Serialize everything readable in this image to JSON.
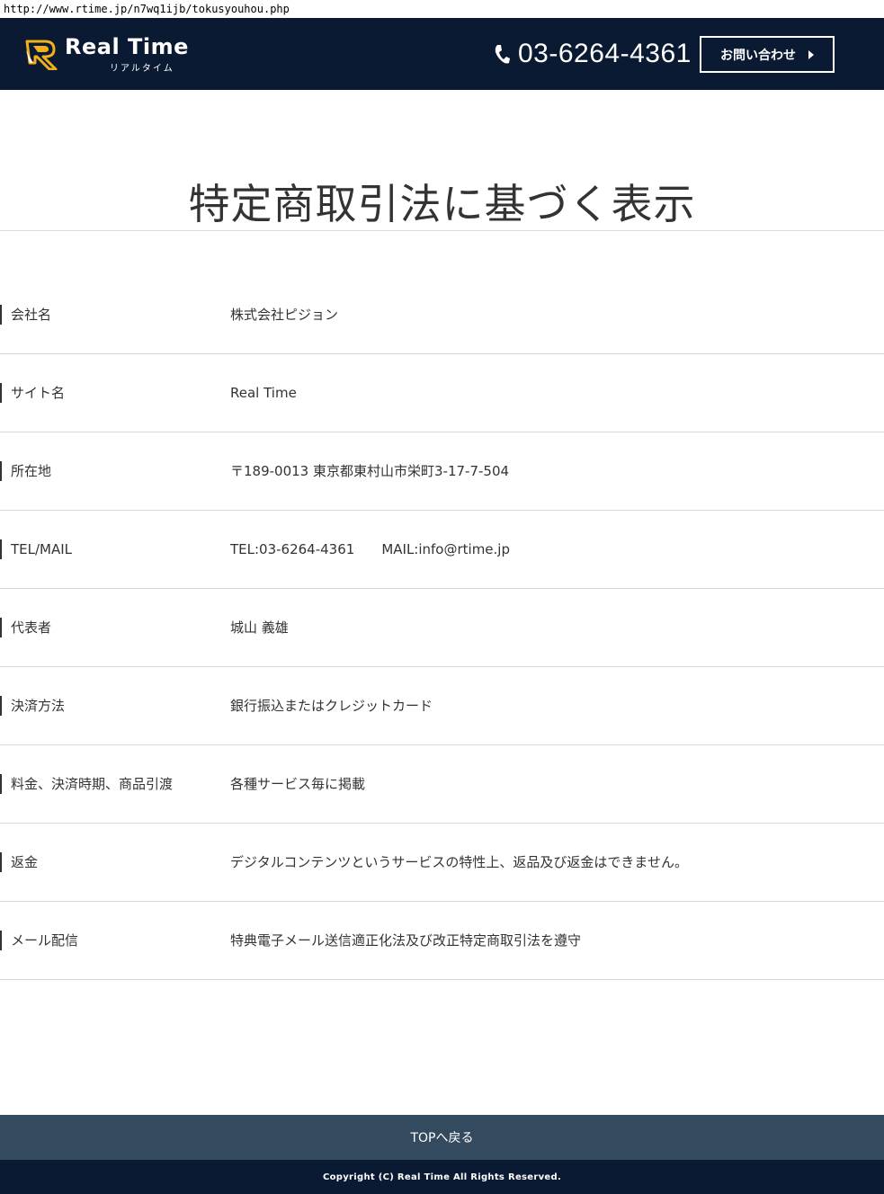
{
  "browser": {
    "url": "http://www.rtime.jp/n7wq1ijb/tokusyouhou.php"
  },
  "header": {
    "logo_text": "Real Time",
    "logo_sub": "リアルタイム",
    "phone": "03-6264-4361",
    "contact_label": "お問い合わせ",
    "colors": {
      "navy": "#0b1a33",
      "logo_gold": "#f2b01e"
    }
  },
  "main": {
    "title": "特定商取引法に基づく表示",
    "rows": [
      {
        "label": "会社名",
        "value": "株式会社ピジョン"
      },
      {
        "label": "サイト名",
        "value": "Real Time"
      },
      {
        "label": "所在地",
        "value": "〒189-0013 東京都東村山市栄町3-17-7-504"
      },
      {
        "label": "TEL/MAIL",
        "value": "TEL:03-6264-4361",
        "value2": "MAIL:info@rtime.jp"
      },
      {
        "label": "代表者",
        "value": "城山 義雄"
      },
      {
        "label": "決済方法",
        "value": "銀行振込またはクレジットカード"
      },
      {
        "label": "料金、決済時期、商品引渡",
        "value": "各種サービス毎に掲載"
      },
      {
        "label": "返金",
        "value": "デジタルコンテンツというサービスの特性上、返品及び返金はできません。"
      },
      {
        "label": "メール配信",
        "value": "特典電子メール送信適正化法及び改正特定商取引法を遵守"
      }
    ]
  },
  "top_link": {
    "label": "TOPへ戻る",
    "color": "#344a5e"
  },
  "footer": {
    "copyright": "Copyright (C) Real Time All Rights Reserved."
  }
}
